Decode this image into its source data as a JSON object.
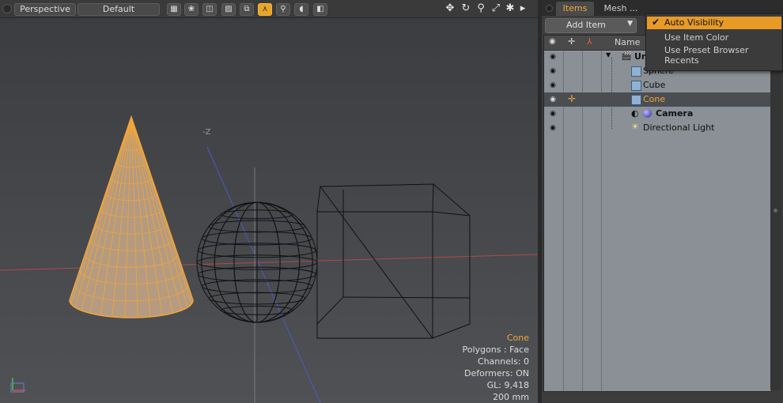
{
  "viewport": {
    "view_mode": "Perspective",
    "shading": "Default",
    "axis_label": "-Z",
    "info": {
      "selected": "Cone",
      "polygons": "Polygons : Face",
      "channels": "Channels: 0",
      "deformers": "Deformers: ON",
      "gl": "GL: 9,418",
      "scale": "200 mm"
    }
  },
  "panel": {
    "tabs": [
      "Items",
      "Mesh ..."
    ],
    "add_item_label": "Add Item",
    "column_name": "Name",
    "items": [
      {
        "label": "Un",
        "icon": "scene-icon"
      },
      {
        "label": "Sphere",
        "icon": "mesh-icon"
      },
      {
        "label": "Cube",
        "icon": "mesh-icon"
      },
      {
        "label": "Cone",
        "icon": "mesh-icon"
      },
      {
        "label": "Camera",
        "icon": "camera-icon"
      },
      {
        "label": "Directional Light",
        "icon": "light-icon"
      }
    ]
  },
  "dropdown": {
    "items": [
      "Auto Visibility",
      "Use Item Color",
      "Use Preset Browser Recents"
    ],
    "checked": "Auto Visibility"
  },
  "colors": {
    "accent": "#e89a27",
    "selection_text": "#f2a63a"
  }
}
